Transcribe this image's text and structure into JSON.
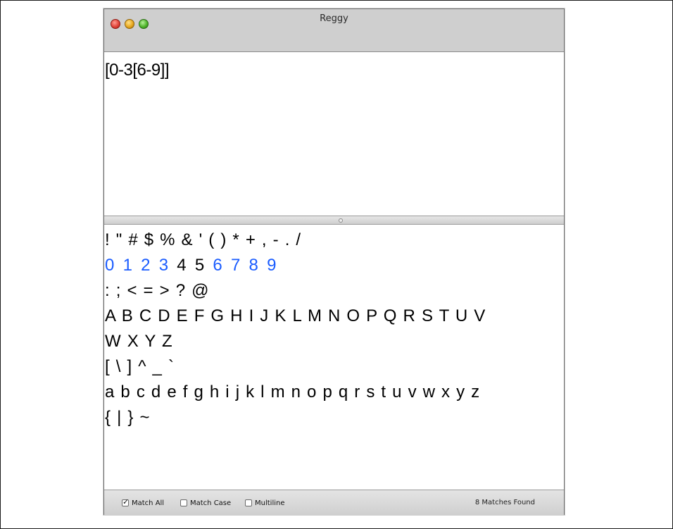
{
  "window": {
    "title": "Reggy"
  },
  "regex": {
    "value": "[0-3[6-9]]"
  },
  "sample": {
    "lines": [
      "! \" # $ % & ' ( ) * + , - . /",
      "",
      ": ; < = > ? @",
      "A B C D E F G H I J K L M N O P Q R S T U V",
      "W X Y Z",
      "[ \\ ] ^ _ `",
      "a b c d e f g h i j k l m n o p q r s t u v w x y z",
      "{ | } ~"
    ],
    "digits": [
      "0",
      "1",
      "2",
      "3",
      "4",
      "5",
      "6",
      "7",
      "8",
      "9"
    ],
    "digit_match": [
      true,
      true,
      true,
      true,
      false,
      false,
      true,
      true,
      true,
      true
    ],
    "match_color": "#1a5cff"
  },
  "options": {
    "match_all": {
      "label": "Match All",
      "checked": true
    },
    "match_case": {
      "label": "Match Case",
      "checked": false
    },
    "multiline": {
      "label": "Multiline",
      "checked": false
    }
  },
  "status": {
    "matches": "8 Matches Found"
  }
}
